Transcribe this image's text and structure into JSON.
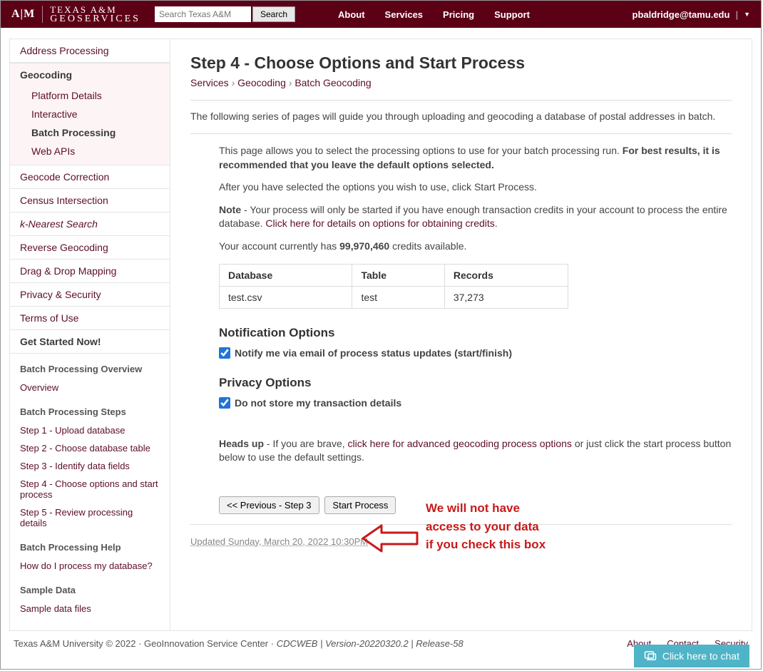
{
  "header": {
    "logo_atm": "A|M",
    "logo_top": "TEXAS A&M",
    "logo_bottom": "GEOSERVICES",
    "search_placeholder": "Search Texas A&M",
    "search_button": "Search",
    "nav": [
      "About",
      "Services",
      "Pricing",
      "Support"
    ],
    "user_email": "pbaldridge@tamu.edu"
  },
  "sidebar": {
    "main_items": [
      {
        "label": "Address Processing"
      },
      {
        "label": "Geocoding",
        "active_parent": true,
        "children": [
          {
            "label": "Platform Details"
          },
          {
            "label": "Interactive"
          },
          {
            "label": "Batch Processing",
            "active": true
          },
          {
            "label": "Web APIs"
          }
        ]
      },
      {
        "label": "Geocode Correction"
      },
      {
        "label": "Census Intersection"
      },
      {
        "label": "k-Nearest Search",
        "italic": true
      },
      {
        "label": "Reverse Geocoding"
      },
      {
        "label": "Drag & Drop Mapping"
      },
      {
        "label": "Privacy & Security"
      },
      {
        "label": "Terms of Use"
      },
      {
        "label": "Get Started Now!",
        "bold": true
      }
    ],
    "groups": [
      {
        "title": "Batch Processing Overview",
        "links": [
          "Overview"
        ]
      },
      {
        "title": "Batch Processing Steps",
        "links": [
          "Step 1 - Upload database",
          "Step 2 - Choose database table",
          "Step 3 - Identify data fields",
          "Step 4 - Choose options and start process",
          "Step 5 - Review processing details"
        ]
      },
      {
        "title": "Batch Processing Help",
        "links": [
          "How do I process my database?"
        ]
      },
      {
        "title": "Sample Data",
        "links": [
          "Sample data files"
        ]
      }
    ]
  },
  "main": {
    "title": "Step 4 - Choose Options and Start Process",
    "breadcrumb": {
      "items": [
        "Services",
        "Geocoding",
        "Batch Geocoding"
      ]
    },
    "intro": "The following series of pages will guide you through uploading and geocoding a database of postal addresses in batch.",
    "p1_a": "This page allows you to select the processing options to use for your batch processing run. ",
    "p1_b": "For best results, it is recommended that you leave the default options selected.",
    "p2": "After you have selected the options you wish to use, click Start Process.",
    "note_label": "Note",
    "note_text": " - Your process will only be started if you have enough transaction credits in your account to process the entire database. ",
    "note_link": "Click here for details on options for obtaining credits",
    "credits_a": "Your account currently has ",
    "credits_value": "99,970,460",
    "credits_b": " credits available.",
    "table": {
      "headers": [
        "Database",
        "Table",
        "Records"
      ],
      "row": [
        "test.csv",
        "test",
        "37,273"
      ]
    },
    "notification_title": "Notification Options",
    "notification_checkbox": "Notify me via email of process status updates (start/finish)",
    "privacy_title": "Privacy Options",
    "privacy_checkbox": "Do not store my transaction details",
    "annotation": "We will not have\naccess to your data\nif you check this box",
    "headsup_label": "Heads up",
    "headsup_a": " - If you are brave, ",
    "headsup_link": "click here for advanced geocoding process options",
    "headsup_b": " or just click the start process button below to use the default settings.",
    "prev_button": "<< Previous - Step 3",
    "start_button": "Start Process",
    "updated": "Updated Sunday, March 20, 2022 10:30PM"
  },
  "footer": {
    "left_a": "Texas A&M University © 2022 · GeoInnovation Service Center · ",
    "left_b": "CDCWEB | Version-20220320.2 | Release-58",
    "right": [
      "About",
      "Contact",
      "Security"
    ]
  },
  "chat": {
    "label": "Click here to chat"
  }
}
